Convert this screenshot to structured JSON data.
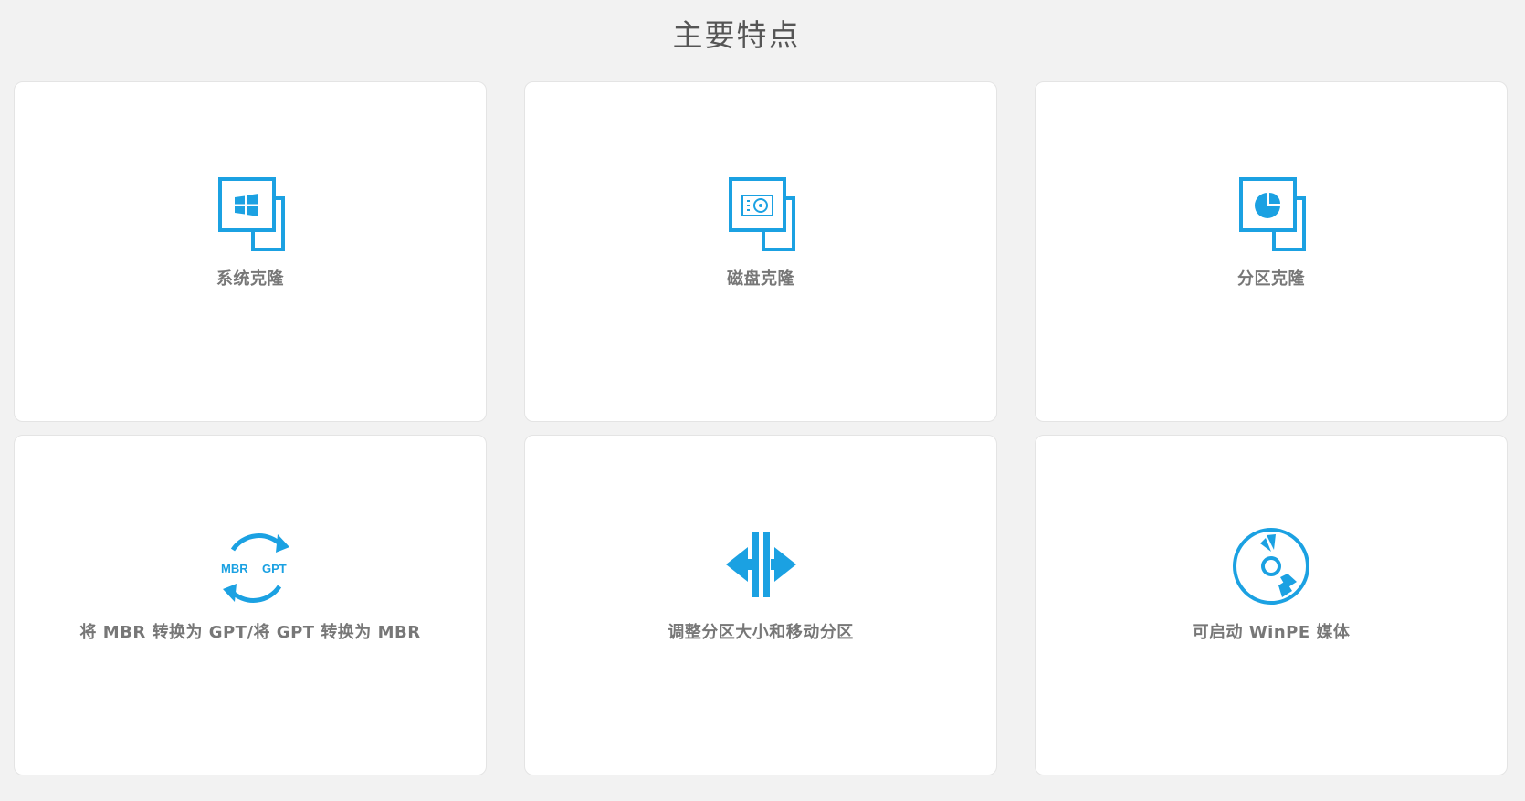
{
  "page": {
    "title": "主要特点"
  },
  "features": [
    {
      "label": "系统克隆",
      "icon": "windows-clone-icon"
    },
    {
      "label": "磁盘克隆",
      "icon": "disk-clone-icon"
    },
    {
      "label": "分区克隆",
      "icon": "partition-clone-icon"
    },
    {
      "label": "将 MBR 转换为 GPT/将 GPT 转换为 MBR",
      "icon": "mbr-gpt-convert-icon",
      "icon_text": {
        "left": "MBR",
        "right": "GPT"
      }
    },
    {
      "label": "调整分区大小和移动分区",
      "icon": "resize-partition-icon"
    },
    {
      "label": "可启动 WinPE 媒体",
      "icon": "bootable-disc-icon"
    }
  ],
  "colors": {
    "accent": "#1ba1e2",
    "background": "#f2f2f2",
    "card": "#ffffff",
    "label": "#777777",
    "title": "#555555"
  }
}
